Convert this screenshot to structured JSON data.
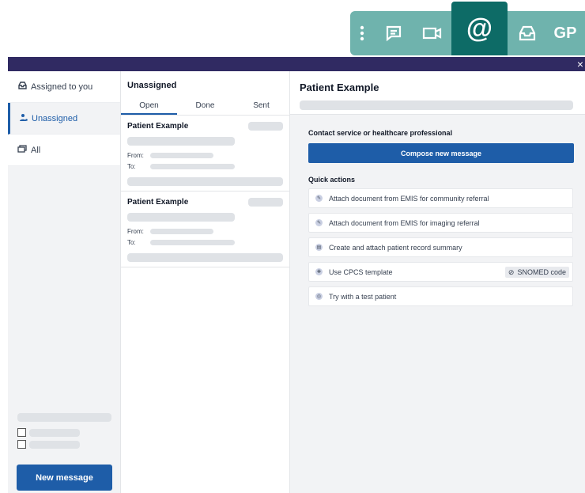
{
  "toolbar": {
    "gp_label": "GP",
    "at_label": "@",
    "icons": [
      "kebab-icon",
      "chat-icon",
      "video-icon",
      "at-icon",
      "inbox-icon"
    ]
  },
  "close_label": "×",
  "sidebar": {
    "items": [
      {
        "label": "Assigned to you",
        "icon": "inbox-icon"
      },
      {
        "label": "Unassigned",
        "icon": "unassigned-user-icon"
      },
      {
        "label": "All",
        "icon": "stacked-inbox-icon"
      }
    ],
    "new_message_label": "New message"
  },
  "list": {
    "title": "Unassigned",
    "tabs": [
      "Open",
      "Done",
      "Sent"
    ],
    "messages": [
      {
        "name": "Patient Example",
        "from_label": "From:",
        "to_label": "To:"
      },
      {
        "name": "Patient Example",
        "from_label": "From:",
        "to_label": "To:"
      }
    ]
  },
  "detail": {
    "title": "Patient Example",
    "contact_heading": "Contact service or healthcare professional",
    "compose_label": "Compose new message",
    "quick_actions_heading": "Quick actions",
    "actions": [
      {
        "label": "Attach document from EMIS for community referral"
      },
      {
        "label": "Attach document from EMIS for imaging referral"
      },
      {
        "label": "Create and attach patient record summary"
      },
      {
        "label": "Use CPCS template",
        "badge": "SNOMED code"
      },
      {
        "label": "Try with a test patient"
      }
    ]
  },
  "colors": {
    "primary": "#1e5da8",
    "toolbar": "#6fb3ad",
    "toolbar_active": "#0d6b66",
    "header_bar": "#302a62"
  }
}
